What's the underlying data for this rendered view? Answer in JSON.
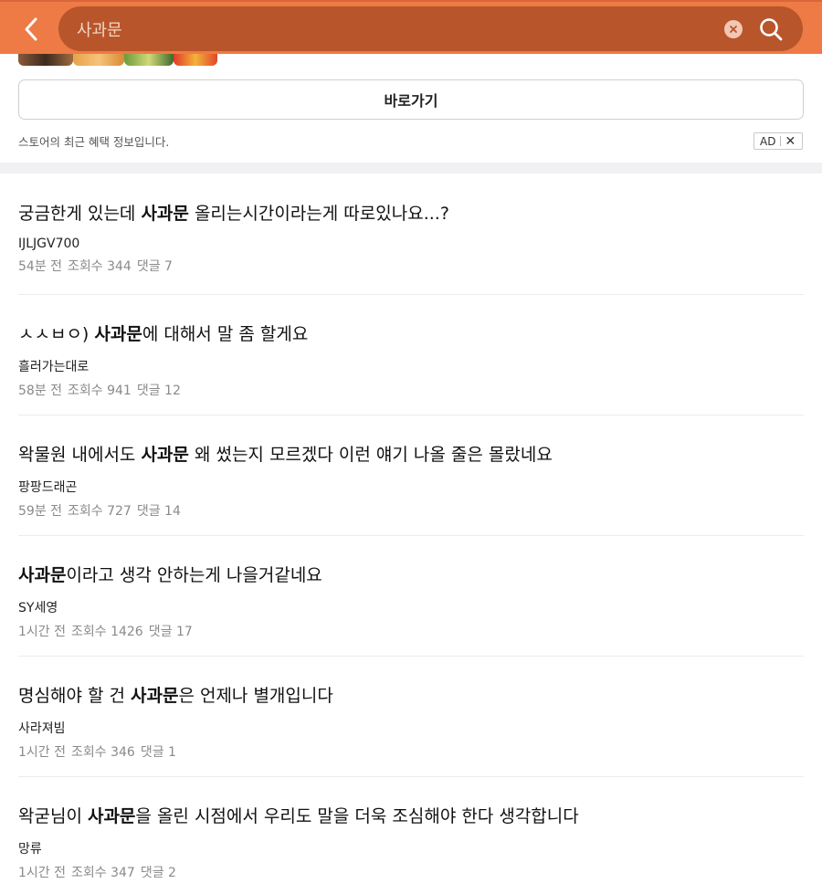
{
  "search": {
    "query": "사과문"
  },
  "ad": {
    "goto_label": "바로가기",
    "store_info": "스토어의 최근 혜택 정보입니다.",
    "badge": "AD",
    "badge_close": "✕"
  },
  "posts": [
    {
      "pre": "궁금한게 있는데 ",
      "kw": "사과문",
      "post": " 올리는시간이라는게 따로있나요...?",
      "author": "IJLJGV700",
      "time": "54분 전",
      "views": "조회수 344",
      "comments": "댓글 7"
    },
    {
      "pre": "ㅅㅅㅂㅇ) ",
      "kw": "사과문",
      "post": "에 대해서 말 좀 할게요",
      "author": "흘러가는대로",
      "time": "58분 전",
      "views": "조회수 941",
      "comments": "댓글 12"
    },
    {
      "pre": "왁물원 내에서도 ",
      "kw": "사과문",
      "post": " 왜 썼는지 모르겠다 이런 얘기 나올 줄은 몰랐네요",
      "author": "팡팡드래곤",
      "time": "59분 전",
      "views": "조회수 727",
      "comments": "댓글 14"
    },
    {
      "pre": "",
      "kw": "사과문",
      "post": "이라고 생각 안하는게 나을거같네요",
      "author": "SY세영",
      "time": "1시간 전",
      "views": "조회수 1426",
      "comments": "댓글 17"
    },
    {
      "pre": "명심해야 할 건 ",
      "kw": "사과문",
      "post": "은 언제나 별개입니다",
      "author": "사라져빔",
      "time": "1시간 전",
      "views": "조회수 346",
      "comments": "댓글 1"
    },
    {
      "pre": "왁굳님이 ",
      "kw": "사과문",
      "post": "을 올린 시점에서 우리도 말을 더욱 조심해야 한다 생각합니다",
      "author": "망류",
      "time": "1시간 전",
      "views": "조회수 347",
      "comments": "댓글 2"
    }
  ]
}
